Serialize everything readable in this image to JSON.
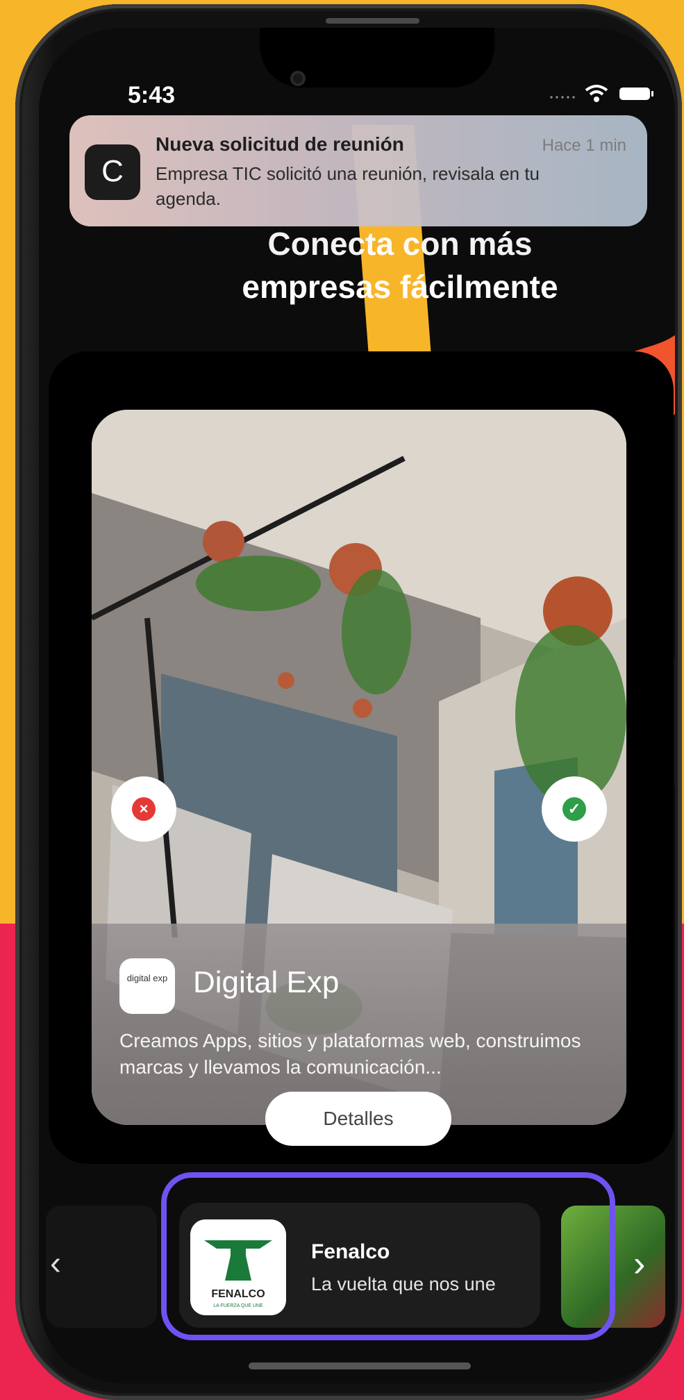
{
  "status_bar": {
    "time": "5:43"
  },
  "notification": {
    "app_icon_letter": "C",
    "title": "Nueva solicitud de reunión",
    "time": "Hace 1 min",
    "body": "Empresa TIC solicitó una reunión, revisala en tu agenda."
  },
  "headline": {
    "line1": "Conecta con más",
    "line2": "empresas fácilmente"
  },
  "company_card": {
    "logo_text": "digital exp",
    "name": "Digital Exp",
    "description": "Creamos Apps, sitios y plataformas web, construimos marcas y llevamos la comunicación...",
    "details_label": "Detalles",
    "reject_icon": "×",
    "accept_icon": "✓"
  },
  "carousel": {
    "left_arrow": "‹",
    "right_arrow": "›",
    "selected": {
      "name": "Fenalco",
      "tagline": "La vuelta que nos une",
      "logo_text": "FENALCO",
      "logo_subtext": "LA FUERZA QUE UNE"
    }
  },
  "colors": {
    "background_top": "#F7B52A",
    "background_bottom": "#EC2450",
    "selection_frame": "#6F52F0",
    "reject": "#E53935",
    "accept": "#2E9E48"
  }
}
